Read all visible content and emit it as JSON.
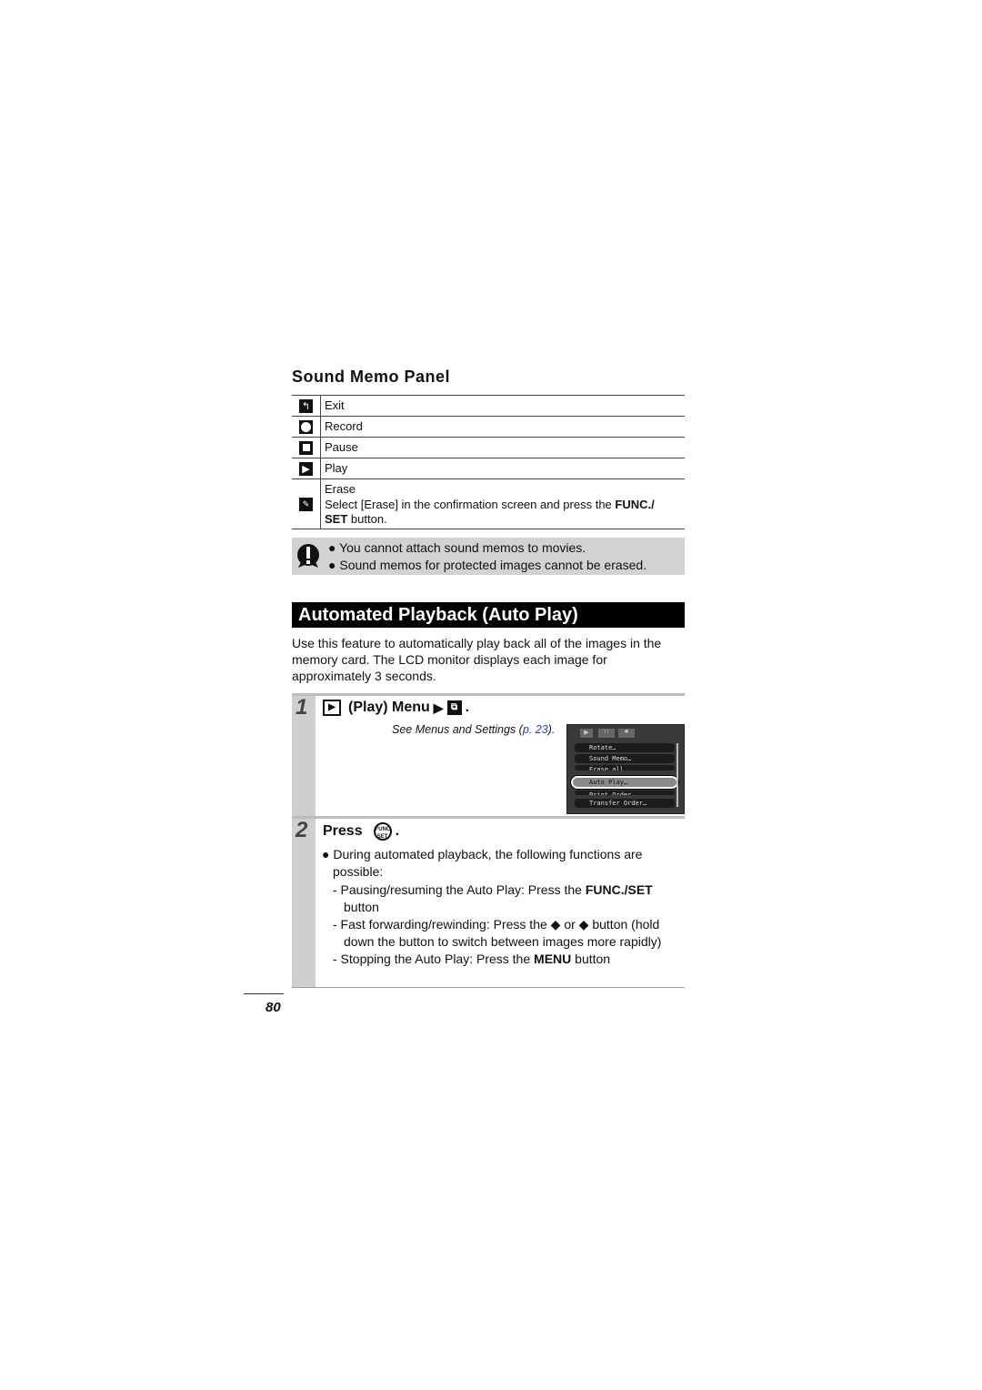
{
  "sound_memo_panel": {
    "title": "Sound Memo Panel",
    "rows": [
      {
        "icon": "exit-icon",
        "label": "Exit"
      },
      {
        "icon": "record-icon",
        "label": "Record"
      },
      {
        "icon": "pause-icon",
        "label": "Pause"
      },
      {
        "icon": "play-icon",
        "label": "Play"
      },
      {
        "icon": "erase-icon",
        "label": "Erase",
        "desc_pre": "Select [Erase] in the confirmation screen and press the ",
        "desc_bold1": "FUNC./",
        "desc_bold2": "SET",
        "desc_post": " button."
      }
    ]
  },
  "caution": {
    "icon": "caution-icon",
    "items": [
      "You cannot attach sound memos to movies.",
      "Sound memos for protected images cannot be erased."
    ]
  },
  "section": {
    "title": "Automated Playback (Auto Play)",
    "intro": "Use this feature to automatically play back all of the images in the memory card. The LCD monitor displays each image for approximately 3 seconds."
  },
  "step1": {
    "number": "1",
    "title": "(Play) Menu",
    "see_pre": "See Menus and Settings (",
    "see_link": "p. 23",
    "see_post": ").",
    "link_color": "#1a3fd6",
    "lcd": {
      "tabs": [
        "▶",
        "↑↑",
        "♣"
      ],
      "items": [
        "Rotate…",
        "Sound Memo…",
        "Erase all…",
        "Auto Play…",
        "Print Order…",
        "Transfer Order…"
      ],
      "selected": "Auto Play…"
    }
  },
  "step2": {
    "number": "2",
    "title": "Press",
    "func_icon_text": "FUNC SET",
    "bullet": "During automated playback, the following functions are possible:",
    "sub1_pre": "- Pausing/resuming the Auto Play: Press the ",
    "sub1_bold": "FUNC./SET",
    "sub1_post": " button",
    "sub2_pre": "- Fast forwarding/rewinding: Press the ",
    "sub2_or": " or ",
    "sub2_post": " button (hold down the button to switch between images more rapidly)",
    "sub3_pre": "- Stopping the Auto Play: Press the ",
    "sub3_bold": "MENU",
    "sub3_post": " button"
  },
  "page_number": "80"
}
